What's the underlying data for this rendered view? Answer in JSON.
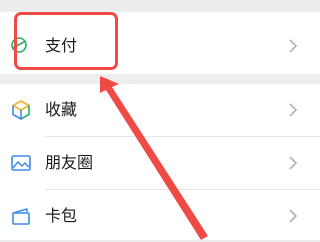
{
  "menu": {
    "pay": {
      "label": "支付",
      "icon": "pay-icon"
    },
    "items": [
      {
        "label": "收藏",
        "icon": "favorites-cube-icon"
      },
      {
        "label": "朋友圈",
        "icon": "moments-image-icon"
      },
      {
        "label": "卡包",
        "icon": "card-wallet-icon"
      }
    ]
  },
  "colors": {
    "pay_icon": "#2bae67",
    "favorites_icon_top": "#f0b02a",
    "favorites_icon_side": "#3e8be8",
    "moments_icon": "#3e8be8",
    "wallet_icon": "#3e8be8",
    "annotation": "#f04a45",
    "chevron": "#b2b2b2"
  }
}
